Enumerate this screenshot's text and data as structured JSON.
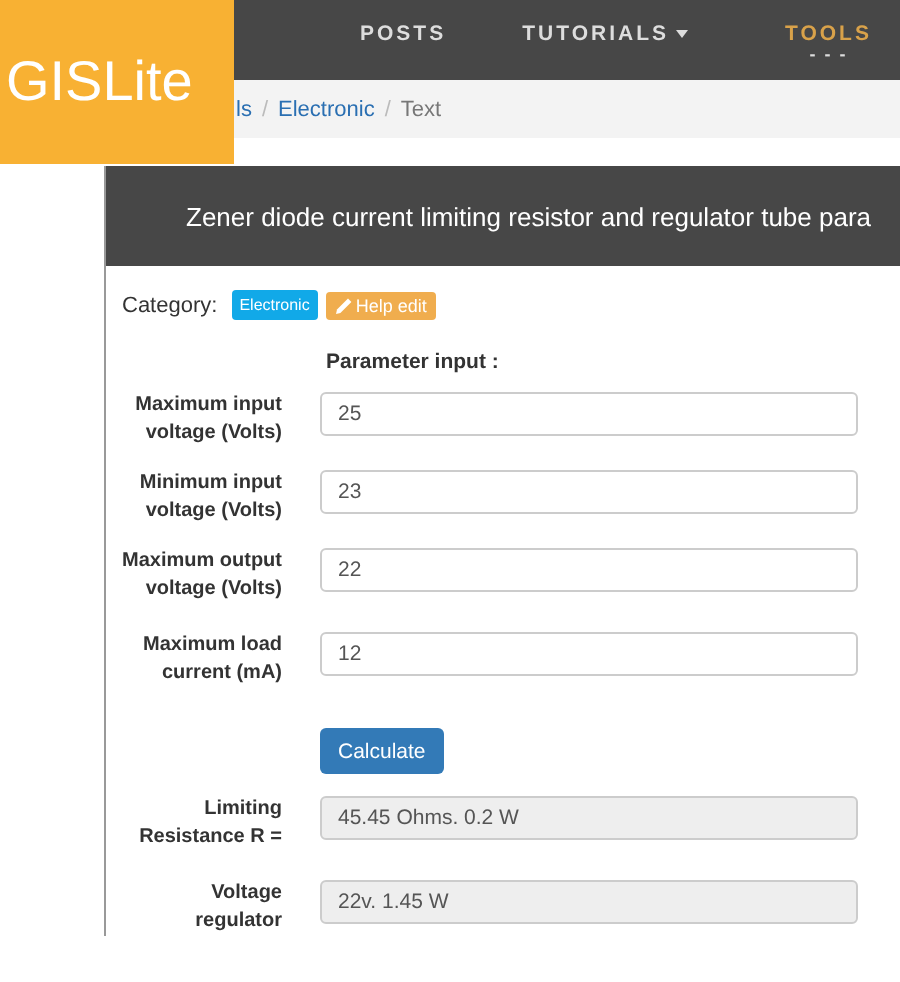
{
  "logo": "GISLite",
  "nav": [
    {
      "label": "POSTS",
      "selected": false,
      "caret": false
    },
    {
      "label": "TUTORIALS",
      "selected": false,
      "caret": true
    },
    {
      "label": "TOOLS",
      "selected": true,
      "caret": false,
      "marker": "- - -"
    }
  ],
  "breadcrumb": [
    {
      "label": "ls",
      "current": false
    },
    {
      "label": "Electronic",
      "current": false
    },
    {
      "label": "Text",
      "current": true
    }
  ],
  "breadcrumb_separator": "/",
  "card": {
    "title": "Zener diode current limiting resistor and regulator tube para",
    "category_label": "Category:",
    "category_tag": "Electronic",
    "help_button": "Help edit",
    "parameter_heading": "Parameter input :",
    "inputs": [
      {
        "label": "Maximum input voltage (Volts)",
        "value": "25"
      },
      {
        "label": "Minimum input voltage (Volts)",
        "value": "23"
      },
      {
        "label": "Maximum output voltage (Volts)",
        "value": "22"
      },
      {
        "label": "Maximum load current (mA)",
        "value": "12"
      }
    ],
    "calculate_button": "Calculate",
    "outputs": [
      {
        "label": "Limiting Resistance R =",
        "value": "45.45 Ohms. 0.2 W",
        "disabled": true
      },
      {
        "label": "Voltage regulator",
        "value": "22v. 1.45 W",
        "disabled": true
      }
    ]
  }
}
